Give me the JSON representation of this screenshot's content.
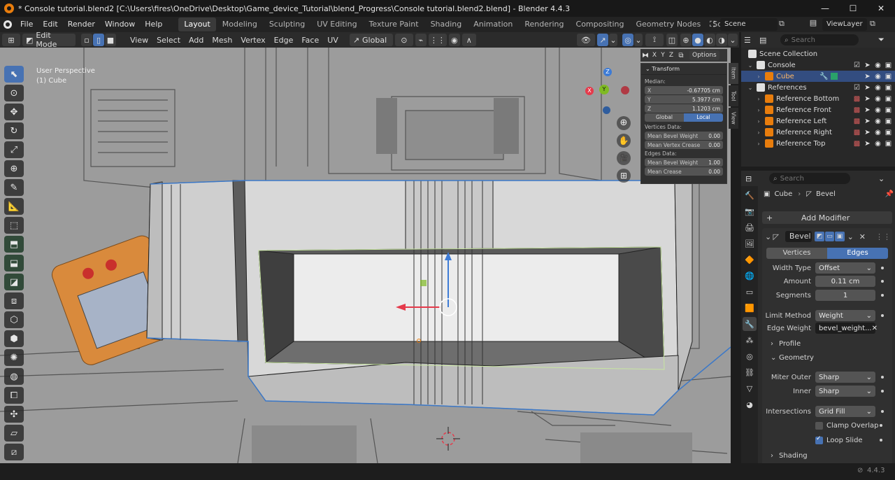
{
  "window": {
    "title": "* Console tutorial.blend2 [C:\\Users\\fires\\OneDrive\\Desktop\\Game_device_Tutorial\\blend_Progress\\Console tutorial.blend2.blend] - Blender 4.4.3",
    "minimize": "—",
    "maximize": "☐",
    "close": "✕"
  },
  "menu": [
    "File",
    "Edit",
    "Render",
    "Window",
    "Help"
  ],
  "workspaces": [
    "Layout",
    "Modeling",
    "Sculpting",
    "UV Editing",
    "Texture Paint",
    "Shading",
    "Animation",
    "Rendering",
    "Compositing",
    "Geometry Nodes",
    "Scripting"
  ],
  "workspace_add": "+",
  "scene": {
    "name": "Scene",
    "view_layer": "ViewLayer"
  },
  "viewport_header": {
    "mode": "Edit Mode",
    "menus": [
      "View",
      "Select",
      "Add",
      "Mesh",
      "Vertex",
      "Edge",
      "Face",
      "UV"
    ],
    "orientation": "Global",
    "options": "Options"
  },
  "viewport": {
    "perspective": "User Perspective",
    "object": "(1) Cube",
    "axes": {
      "x": "X",
      "y": "Y",
      "z": "Z"
    },
    "xyz": [
      "X",
      "Y",
      "Z"
    ]
  },
  "transform_panel": {
    "title": "Transform",
    "median_label": "Median:",
    "median": [
      {
        "axis": "X",
        "value": "-0.67705 cm"
      },
      {
        "axis": "Y",
        "value": "5.3977 cm"
      },
      {
        "axis": "Z",
        "value": "1.1203 cm"
      }
    ],
    "space": {
      "global": "Global",
      "local": "Local",
      "active": "Local"
    },
    "vertices_label": "Vertices Data:",
    "vertices": [
      {
        "label": "Mean Bevel Weight",
        "value": "0.00"
      },
      {
        "label": "Mean Vertex Crease",
        "value": "0.00"
      }
    ],
    "edges_label": "Edges Data:",
    "edges": [
      {
        "label": "Mean Bevel Weight",
        "value": "1.00"
      },
      {
        "label": "Mean Crease",
        "value": "0.00"
      }
    ]
  },
  "side_tabs": [
    "Item",
    "Tool",
    "View"
  ],
  "outliner": {
    "search_placeholder": "Search",
    "items": [
      {
        "label": "Scene Collection",
        "level": 0,
        "type": "collection"
      },
      {
        "label": "Console",
        "level": 1,
        "type": "collection"
      },
      {
        "label": "Cube",
        "level": 2,
        "type": "mesh",
        "selected": true
      },
      {
        "label": "References",
        "level": 1,
        "type": "collection"
      },
      {
        "label": "Reference Bottom",
        "level": 2,
        "type": "image"
      },
      {
        "label": "Reference Front",
        "level": 2,
        "type": "image"
      },
      {
        "label": "Reference Left",
        "level": 2,
        "type": "image"
      },
      {
        "label": "Reference Right",
        "level": 2,
        "type": "image"
      },
      {
        "label": "Reference Top",
        "level": 2,
        "type": "image"
      }
    ]
  },
  "properties": {
    "search_placeholder": "Search",
    "breadcrumb": {
      "object": "Cube",
      "modifier": "Bevel"
    },
    "add_modifier": "Add Modifier",
    "modifier_name": "Bevel",
    "affect": {
      "vertices": "Vertices",
      "edges": "Edges",
      "active": "Edges"
    },
    "fields": {
      "width_type": {
        "label": "Width Type",
        "value": "Offset"
      },
      "amount": {
        "label": "Amount",
        "value": "0.11 cm"
      },
      "segments": {
        "label": "Segments",
        "value": "1"
      },
      "limit_method": {
        "label": "Limit Method",
        "value": "Weight"
      },
      "edge_weight": {
        "label": "Edge Weight",
        "value": "bevel_weight..."
      },
      "miter_outer": {
        "label": "Miter Outer",
        "value": "Sharp"
      },
      "inner": {
        "label": "Inner",
        "value": "Sharp"
      },
      "intersections": {
        "label": "Intersections",
        "value": "Grid Fill"
      }
    },
    "sections": {
      "profile": "Profile",
      "geometry": "Geometry",
      "shading": "Shading"
    },
    "clamp_overlap": {
      "label": "Clamp Overlap",
      "checked": false
    },
    "loop_slide": {
      "label": "Loop Slide",
      "checked": true
    }
  },
  "status": {
    "version": "4.4.3"
  },
  "colors": {
    "accent": "#4772b3",
    "axis_x": "#e53a4b",
    "axis_y": "#7fba24",
    "axis_z": "#3d7bd6",
    "edit_orange": "#e87d0d"
  }
}
